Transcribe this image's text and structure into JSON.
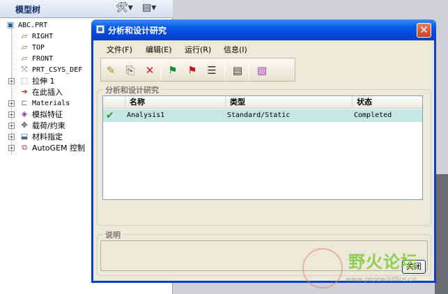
{
  "tree": {
    "title": "模型树",
    "items": [
      {
        "label": "ABC.PRT",
        "icon": "part-icon"
      },
      {
        "label": "RIGHT",
        "icon": "datum-plane-icon"
      },
      {
        "label": "TOP",
        "icon": "datum-plane-icon"
      },
      {
        "label": "FRONT",
        "icon": "datum-plane-icon"
      },
      {
        "label": "PRT_CSYS_DEF",
        "icon": "csys-icon"
      },
      {
        "label": "拉伸 1",
        "icon": "extrude-icon"
      },
      {
        "label": "在此插入",
        "icon": "insert-arrow-icon"
      },
      {
        "label": "Materials",
        "icon": "materials-icon"
      },
      {
        "label": "模拟特征",
        "icon": "simulation-feature-icon"
      },
      {
        "label": "载荷/约束",
        "icon": "load-constraint-icon"
      },
      {
        "label": "材料指定",
        "icon": "material-assign-icon"
      },
      {
        "label": "AutoGEM 控制",
        "icon": "autogem-icon"
      }
    ]
  },
  "dialog": {
    "title": "分析和设计研究",
    "menu": [
      "文件(F)",
      "编辑(E)",
      "运行(R)",
      "信息(I)"
    ],
    "toolbar_icons": [
      "pencil-icon",
      "copy-icon",
      "delete-icon",
      "green-flag-icon",
      "red-flag-icon",
      "list-icon",
      "report-icon",
      "results-icon"
    ],
    "group_title": "分析和设计研究",
    "columns": [
      "名称",
      "类型",
      "状态"
    ],
    "rows": [
      {
        "name": "Analysis1",
        "type": "Standard/Static",
        "status": "Completed"
      }
    ],
    "desc_title": "说明",
    "close_label": "关闭"
  },
  "watermark": {
    "text": "野火论坛",
    "url": "www.proewildfire.cn"
  }
}
